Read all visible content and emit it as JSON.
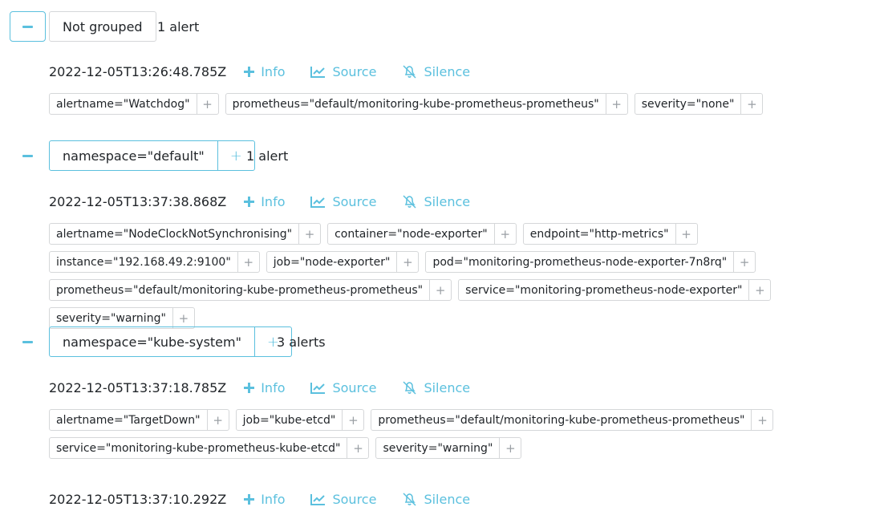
{
  "groups": [
    {
      "label": "Not grouped",
      "count": "1 alert",
      "alerts": [
        {
          "timestamp": "2022-12-05T13:26:48.785Z",
          "labels": [
            "alertname=\"Watchdog\"",
            "prometheus=\"default/monitoring-kube-prometheus-prometheus\"",
            "severity=\"none\""
          ]
        }
      ]
    },
    {
      "label": "namespace=\"default\"",
      "count": "1 alert",
      "alerts": [
        {
          "timestamp": "2022-12-05T13:37:38.868Z",
          "labels": [
            "alertname=\"NodeClockNotSynchronising\"",
            "container=\"node-exporter\"",
            "endpoint=\"http-metrics\"",
            "instance=\"192.168.49.2:9100\"",
            "job=\"node-exporter\"",
            "pod=\"monitoring-prometheus-node-exporter-7n8rq\"",
            "prometheus=\"default/monitoring-kube-prometheus-prometheus\"",
            "service=\"monitoring-prometheus-node-exporter\"",
            "severity=\"warning\""
          ]
        }
      ]
    },
    {
      "label": "namespace=\"kube-system\"",
      "count": "3 alerts",
      "alerts": [
        {
          "timestamp": "2022-12-05T13:37:18.785Z",
          "labels": [
            "alertname=\"TargetDown\"",
            "job=\"kube-etcd\"",
            "prometheus=\"default/monitoring-kube-prometheus-prometheus\"",
            "service=\"monitoring-kube-prometheus-kube-etcd\"",
            "severity=\"warning\""
          ]
        },
        {
          "timestamp": "2022-12-05T13:37:10.292Z",
          "labels": []
        }
      ]
    }
  ],
  "actions": {
    "info": "Info",
    "source": "Source",
    "silence": "Silence"
  },
  "add_symbol": "+",
  "icons": {
    "info": "plus-icon",
    "source": "chart-line-icon",
    "silence": "bell-slash-icon",
    "collapse": "minus-icon"
  },
  "colors": {
    "accent": "#5bc0de",
    "border": "#d5d7d9"
  }
}
